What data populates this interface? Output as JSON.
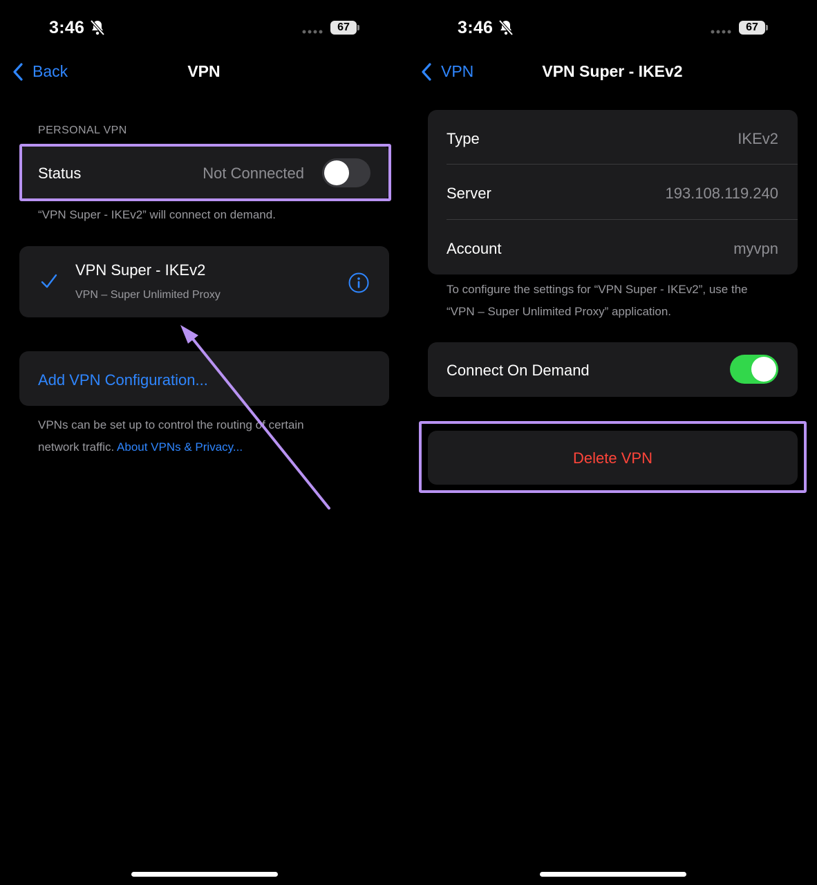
{
  "left": {
    "status_bar": {
      "time": "3:46",
      "battery": "67"
    },
    "nav": {
      "back_label": "Back",
      "title": "VPN"
    },
    "section_header": "PERSONAL VPN",
    "status_row": {
      "label": "Status",
      "value": "Not Connected",
      "toggle_on": false
    },
    "on_demand_note": "“VPN Super - IKEv2” will connect on demand.",
    "vpn_config": {
      "name": "VPN Super - IKEv2",
      "provider": "VPN – Super Unlimited Proxy",
      "selected": true
    },
    "add_config_label": "Add VPN Configuration...",
    "footer": {
      "text_line1": "VPNs can be set up to control the routing of certain",
      "text_line2": "network traffic.",
      "link": "About VPNs & Privacy..."
    }
  },
  "right": {
    "status_bar": {
      "time": "3:46",
      "battery": "67"
    },
    "nav": {
      "back_label": "VPN",
      "title": "VPN Super - IKEv2"
    },
    "details": [
      {
        "label": "Type",
        "value": "IKEv2"
      },
      {
        "label": "Server",
        "value": "193.108.119.240"
      },
      {
        "label": "Account",
        "value": "myvpn"
      }
    ],
    "config_note_line1": "To configure the settings for “VPN Super - IKEv2”, use the",
    "config_note_line2": "“VPN – Super Unlimited Proxy” application.",
    "connect_on_demand": {
      "label": "Connect On Demand",
      "toggle_on": true
    },
    "delete_label": "Delete VPN"
  },
  "colors": {
    "accent_blue": "#2f86ff",
    "toggle_green": "#32d74b",
    "destructive_red": "#ff453a",
    "highlight_purple": "#b892f2",
    "card_bg": "#1c1c1e"
  }
}
